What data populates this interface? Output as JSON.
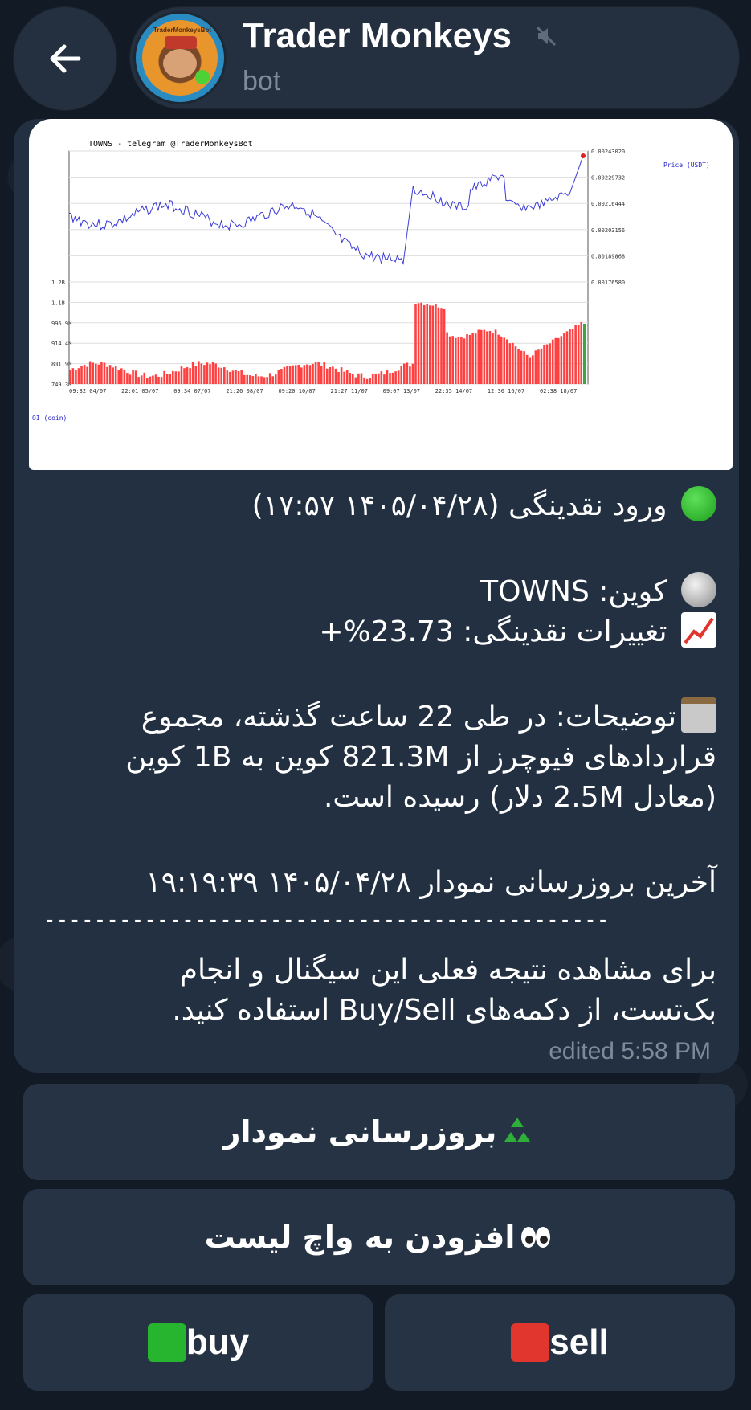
{
  "header": {
    "back_icon": "arrow-left-icon",
    "title": "Trader Monkeys",
    "subtitle": "bot",
    "muted_icon": "speaker-muted-icon",
    "avatar_logo_text": "TraderMonkeysBot"
  },
  "message": {
    "chart_image": {
      "title": "TOWNS - telegram @TraderMonkeysBot",
      "price_axis_label": "Price (USDT)",
      "oi_axis_label": "OI (coin)",
      "price_ticks": [
        "0.00243020",
        "0.00229732",
        "0.00216444",
        "0.00203156",
        "0.00189868",
        "0.00176580"
      ],
      "oi_ticks": [
        "1.2B",
        "1.1B",
        "996.9M",
        "914.4M",
        "831.9M",
        "749.3M"
      ],
      "x_ticks": [
        "09:32 04/07",
        "22:01 05/07",
        "09:34 07/07",
        "21:26 08/07",
        "09:20 10/07",
        "21:27 11/07",
        "09:07 13/07",
        "22:35 14/07",
        "12:30 16/07",
        "02:38 18/07"
      ]
    },
    "headline": "ورود نقدینگی (۱۴۰۵/۰۴/۲۸ ۱۷:۵۷)",
    "headline_icon": "green-circle-icon",
    "coin_line": "کوین: TOWNS",
    "coin_icon": "coin-icon",
    "change_line": "تغییرات نقدینگی: 23.73%+",
    "change_icon": "chart-increasing-icon",
    "desc_line_1": "توضیحات: در طی 22 ساعت گذشته، مجموع",
    "desc_line_2": "قراردادهای فیوچرز از 821.3M کوین به 1B کوین",
    "desc_line_3": "(معادل 2.5M دلار) رسیده است.",
    "desc_icon": "clipboard-icon",
    "update_line": "آخرین بروزرسانی نمودار ۱۴۰۵/۰۴/۲۸ ۱۹:۱۹:۳۹",
    "separator": "------------------------------------------------------",
    "footer_line_1": "برای مشاهده نتیجه فعلی این سیگنال و انجام",
    "footer_line_2": "بک‌تست، از دکمه‌های Buy/Sell استفاده کنید.",
    "edited": "edited 5:58 PM"
  },
  "keyboard": {
    "refresh_label": "بروزرسانی نمودار",
    "refresh_icon": "recycle-icon",
    "watchlist_label": "افزودن به واچ لیست",
    "watchlist_icon": "eyes-icon",
    "buy_label": "buy",
    "buy_icon": "green-square-icon",
    "sell_label": "sell",
    "sell_icon": "red-square-icon"
  },
  "colors": {
    "accent_green": "#27b42e",
    "accent_red": "#e0362e",
    "bubble": "#223041",
    "button": "#253345"
  }
}
